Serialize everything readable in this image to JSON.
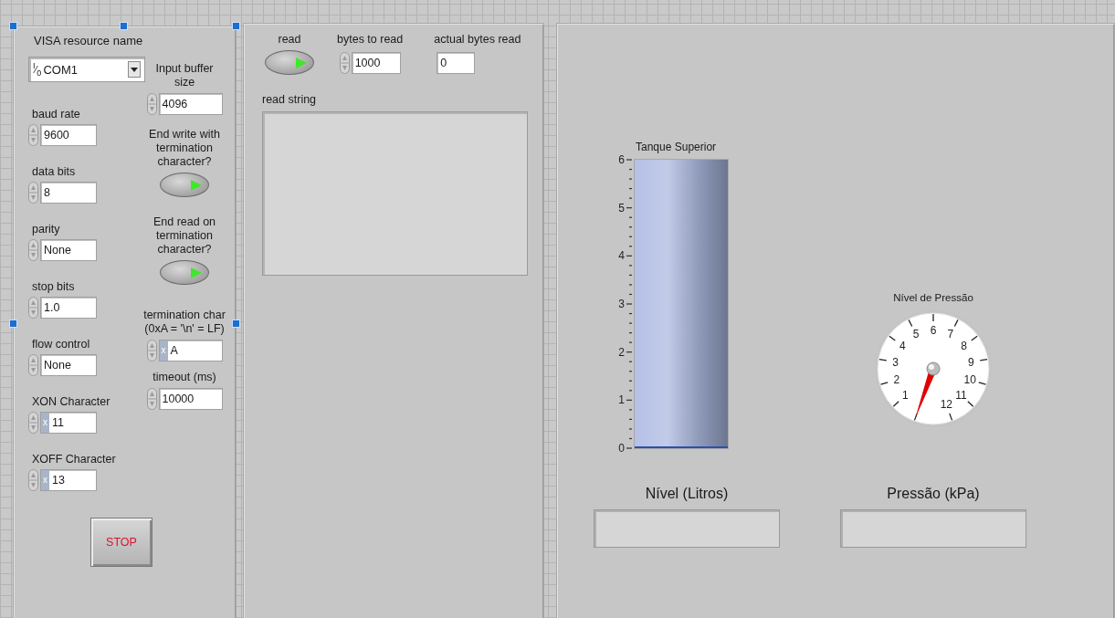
{
  "serial_config": {
    "resource": {
      "label": "VISA resource name",
      "prefix": "$^{I}$⁄$_{0}$",
      "value": "COM1"
    },
    "left_controls": [
      {
        "label": "baud rate",
        "kind": "numeric",
        "value": "9600"
      },
      {
        "label": "data bits",
        "kind": "numeric",
        "value": "8"
      },
      {
        "label": "parity",
        "kind": "numeric",
        "value": "None"
      },
      {
        "label": "stop bits",
        "kind": "numeric",
        "value": "1.0"
      },
      {
        "label": "flow control",
        "kind": "numeric",
        "value": "None"
      },
      {
        "label": "XON Character",
        "kind": "hex",
        "radix": "x",
        "value": "11"
      },
      {
        "label": "XOFF Character",
        "kind": "hex",
        "radix": "x",
        "value": "13"
      }
    ],
    "right_controls": [
      {
        "label": "Input buffer size",
        "kind": "numeric",
        "value": "4096"
      },
      {
        "label": "End write with termination character?",
        "kind": "switch",
        "on": true
      },
      {
        "label": "End read on termination character?",
        "kind": "switch",
        "on": true
      },
      {
        "label": "termination char (0xA = '\\n' = LF)",
        "kind": "hex",
        "radix": "x",
        "value": "A"
      },
      {
        "label": "timeout (ms)",
        "kind": "numeric",
        "value": "10000"
      }
    ],
    "stop_button": "STOP"
  },
  "read_panel": {
    "controls": [
      {
        "label": "read",
        "kind": "switch",
        "on": true
      },
      {
        "label": "bytes to read",
        "kind": "numeric",
        "value": "1000"
      },
      {
        "label": "actual bytes read",
        "kind": "indicator",
        "value": "0"
      }
    ],
    "read_string": {
      "label": "read string"
    }
  },
  "monitor": {
    "tank": {
      "title": "Tanque Superior",
      "scale": [
        "6",
        "5",
        "4",
        "3",
        "2",
        "1",
        "0"
      ],
      "level": 0
    },
    "tank_reading": {
      "label": "Nível (Litros)"
    },
    "gauge": {
      "title": "Nível de Pressão",
      "scale": [
        "1",
        "2",
        "3",
        "4",
        "5",
        "6",
        "7",
        "8",
        "9",
        "10",
        "11",
        "12"
      ]
    },
    "gauge_reading": {
      "label": "Pressão (kPa)"
    }
  }
}
